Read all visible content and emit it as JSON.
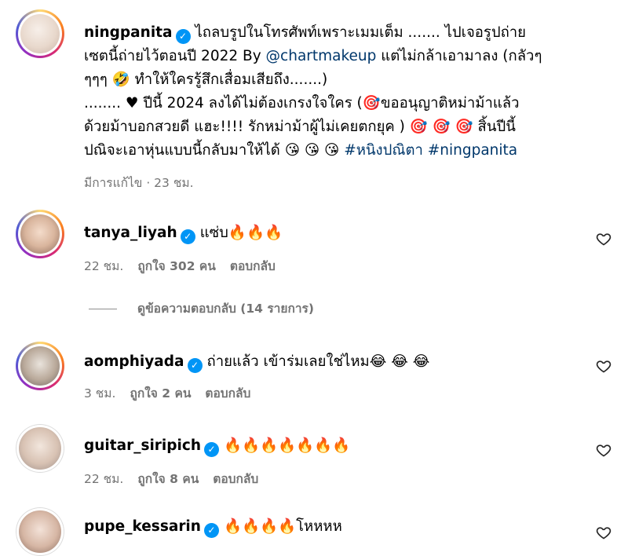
{
  "post": {
    "username": "ningpanita",
    "caption_lines": [
      "ไถลบรูปในโทรศัพท์เพราะเมมเต็ม ....... ไปเจอรูปถ่าย",
      "เซตนี้ถ่ายไว้ตอนปี 2022 By ",
      "@chartmakeup",
      " แต่ไม่กล้าเอามาลง (กลัวๆ",
      "ๆๆๆ 🤣 ทำให้ใครรู้สึกเสื่อมเสียถึง.......)",
      "........ ♥ ปีนี้ 2024 ลงได้ไม่ต้องเกรงใจใคร (🎯ขออนุญาติหม่าม้าแล้ว",
      "ด้วยม้าบอกสวยดี แฮะ!!!! รักหม่าม้าผู้ไม่เคยตกยุค ) 🎯 🎯 🎯 สิ้นปีนี้",
      "ปณิจะเอาหุ่นแบบนี้กลับมาให้ได้ 😘 😘 😘 ",
      "#หนิงปณิตา #ningpanita"
    ],
    "meta": "มีการแก้ไข · 23 ชม."
  },
  "comments": [
    {
      "username": "tanya_liyah",
      "text": "แซ่บ🔥🔥🔥",
      "time": "22 ชม.",
      "likes": "ถูกใจ 302 คน",
      "reply": "ตอบกลับ",
      "view_replies": "ดูข้อความตอบกลับ (14 รายการ)"
    },
    {
      "username": "aomphiyada",
      "text": "ถ่ายแล้ว เข้าร่มเลยใช่ไหม😂 😂 😂",
      "time": "3 ชม.",
      "likes": "ถูกใจ 2 คน",
      "reply": "ตอบกลับ"
    },
    {
      "username": "guitar_siripich",
      "text": "🔥🔥🔥🔥🔥🔥🔥",
      "time": "22 ชม.",
      "likes": "ถูกใจ 8 คน",
      "reply": "ตอบกลับ"
    },
    {
      "username": "pupe_kessarin",
      "text": "🔥🔥🔥🔥โหหหห"
    }
  ],
  "icons": {
    "verified": "verified-badge-icon",
    "heart": "heart-outline-icon"
  },
  "colors": {
    "verified": "#0095f6",
    "link": "#00376b",
    "meta": "#737373"
  }
}
